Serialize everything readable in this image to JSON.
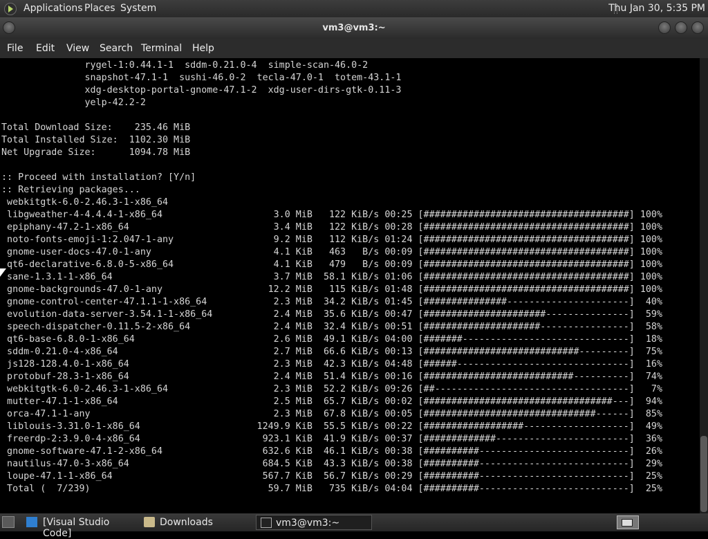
{
  "top_panel": {
    "menus": [
      "Applications",
      "Places",
      "System"
    ],
    "clock": "Thu Jan 30,  5:35 PM"
  },
  "window": {
    "title": "vm3@vm3:~"
  },
  "menubar": [
    "File",
    "Edit",
    "View",
    "Search",
    "Terminal",
    "Help"
  ],
  "terminal": {
    "lines": [
      "               rygel-1:0.44.1-1  sddm-0.21.0-4  simple-scan-46.0-2",
      "               snapshot-47.1-1  sushi-46.0-2  tecla-47.0-1  totem-43.1-1",
      "               xdg-desktop-portal-gnome-47.1-2  xdg-user-dirs-gtk-0.11-3",
      "               yelp-42.2-2",
      "",
      "Total Download Size:    235.46 MiB",
      "Total Installed Size:  1102.30 MiB",
      "Net Upgrade Size:      1094.78 MiB",
      "",
      ":: Proceed with installation? [Y/n]",
      ":: Retrieving packages...",
      " webkitgtk-6.0-2.46.3-1-x86_64",
      " libgweather-4-4.4.4-1-x86_64                    3.0 MiB   122 KiB/s 00:25 [#####################################] 100%",
      " epiphany-47.2-1-x86_64                          3.4 MiB   122 KiB/s 00:28 [#####################################] 100%",
      " noto-fonts-emoji-1:2.047-1-any                  9.2 MiB   112 KiB/s 01:24 [#####################################] 100%",
      " gnome-user-docs-47.0-1-any                      4.1 KiB   463   B/s 00:09 [#####################################] 100%",
      " qt6-declarative-6.8.0-5-x86_64                  4.1 KiB   479   B/s 00:09 [#####################################] 100%",
      " sane-1.3.1-1-x86_64                             3.7 MiB  58.1 KiB/s 01:06 [#####################################] 100%",
      " gnome-backgrounds-47.0-1-any                   12.2 MiB   115 KiB/s 01:48 [#####################################] 100%",
      " gnome-control-center-47.1.1-1-x86_64            2.3 MiB  34.2 KiB/s 01:45 [###############----------------------]  40%",
      " evolution-data-server-3.54.1-1-x86_64           2.4 MiB  35.6 KiB/s 00:47 [######################---------------]  59%",
      " speech-dispatcher-0.11.5-2-x86_64               2.4 MiB  32.4 KiB/s 00:51 [#####################----------------]  58%",
      " qt6-base-6.8.0-1-x86_64                         2.6 MiB  49.1 KiB/s 04:00 [#######------------------------------]  18%",
      " sddm-0.21.0-4-x86_64                            2.7 MiB  66.6 KiB/s 00:13 [############################---------]  75%",
      " js128-128.4.0-1-x86_64                          2.3 MiB  42.3 KiB/s 04:48 [######-------------------------------]  16%",
      " protobuf-28.3-1-x86_64                          2.4 MiB  51.4 KiB/s 00:16 [###########################----------]  74%",
      " webkitgtk-6.0-2.46.3-1-x86_64                   2.3 MiB  52.2 KiB/s 09:26 [##-----------------------------------]   7%",
      " mutter-47.1-1-x86_64                            2.5 MiB  65.7 KiB/s 00:02 [##################################---]  94%",
      " orca-47.1-1-any                                 2.3 MiB  67.8 KiB/s 00:05 [###############################------]  85%",
      " liblouis-3.31.0-1-x86_64                     1249.9 KiB  55.5 KiB/s 00:22 [##################-------------------]  49%",
      " freerdp-2:3.9.0-4-x86_64                      923.1 KiB  41.9 KiB/s 00:37 [#############------------------------]  36%",
      " gnome-software-47.1-2-x86_64                  632.6 KiB  46.1 KiB/s 00:38 [##########---------------------------]  26%",
      " nautilus-47.0-3-x86_64                        684.5 KiB  43.3 KiB/s 00:38 [##########---------------------------]  29%",
      " loupe-47.1-1-x86_64                           567.7 KiB  56.7 KiB/s 00:29 [##########---------------------------]  25%",
      " Total (  7/239)                                59.7 MiB   735 KiB/s 04:04 [##########---------------------------]  25%"
    ]
  },
  "taskbar": {
    "tasks": [
      "[Visual Studio Code]",
      "Downloads",
      "vm3@vm3:~"
    ]
  }
}
